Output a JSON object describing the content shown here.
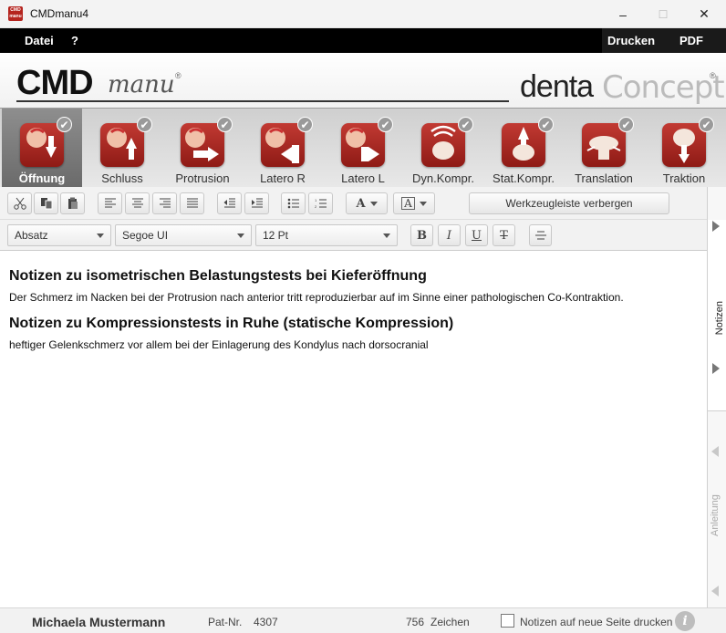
{
  "window": {
    "title": "CMDmanu4",
    "icon_text": "CMD manu",
    "minimize": "–",
    "maximize": "☐",
    "close": "✕"
  },
  "menu": {
    "left": [
      "Datei",
      "?"
    ],
    "right": [
      "Drucken",
      "PDF"
    ]
  },
  "banner": {
    "logo_left_bold": "CMD",
    "logo_left_italic": "manu",
    "logo_left_mark": "®",
    "logo_right_a": "denta",
    "logo_right_b": "Concept",
    "logo_right_mark": "®"
  },
  "tests": [
    {
      "label": "Öffnung",
      "active": true,
      "checked": true
    },
    {
      "label": "Schluss",
      "active": false,
      "checked": true
    },
    {
      "label": "Protrusion",
      "active": false,
      "checked": true
    },
    {
      "label": "Latero R",
      "active": false,
      "checked": true
    },
    {
      "label": "Latero L",
      "active": false,
      "checked": true
    },
    {
      "label": "Dyn.Kompr.",
      "active": false,
      "checked": true
    },
    {
      "label": "Stat.Kompr.",
      "active": false,
      "checked": true
    },
    {
      "label": "Translation",
      "active": false,
      "checked": true
    },
    {
      "label": "Traktion",
      "active": false,
      "checked": true
    }
  ],
  "toolbar": {
    "hide_button": "Werkzeugleiste verbergen",
    "paragraph_style": "Absatz",
    "font": "Segoe UI",
    "size": "12 Pt",
    "bold": "B",
    "italic": "I",
    "underline": "U",
    "strike": "T",
    "text_color": "A",
    "highlight": "A"
  },
  "editor": {
    "heading1": "Notizen zu isometrischen Belastungstests bei Kieferöffnung",
    "text1": "Der Schmerz im Nacken bei der Protrusion nach anterior tritt reproduzierbar auf im Sinne einer pathologischen Co-Kontraktion.",
    "heading2": "Notizen zu Kompressionstests in Ruhe (statische Kompression)",
    "text2": "heftiger Gelenkschmerz vor allem bei der Einlagerung des Kondylus nach dorsocranial"
  },
  "sidepanel": {
    "notizen": "Notizen",
    "anleitung": "Anleitung"
  },
  "status": {
    "patient_name": "Michaela Mustermann",
    "pat_nr_label": "Pat-Nr.",
    "pat_nr": "4307",
    "char_count": "756",
    "char_label": "Zeichen",
    "print_checkbox_label": "Notizen auf neue Seite drucken",
    "info": "i"
  },
  "colors": {
    "accent_red": "#b5251f",
    "menu_black": "#000000"
  }
}
